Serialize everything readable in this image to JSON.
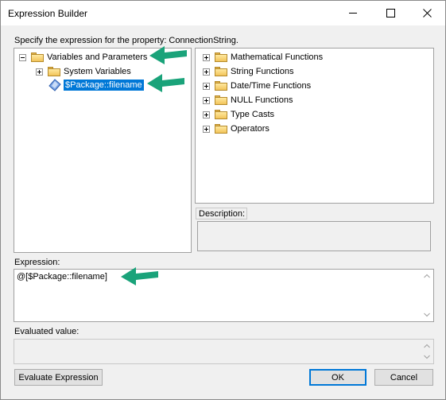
{
  "window": {
    "title": "Expression Builder",
    "minimize_icon": "minimize-icon",
    "maximize_icon": "maximize-icon",
    "close_icon": "close-icon"
  },
  "prompt": "Specify the expression for the property: ConnectionString.",
  "left_tree": {
    "root": {
      "label": "Variables and Parameters",
      "expanded": true
    },
    "children": [
      {
        "label": "System Variables",
        "expanded": false
      },
      {
        "label": "$Package::filename",
        "selected": true
      }
    ]
  },
  "right_tree": {
    "items": [
      {
        "label": "Mathematical Functions"
      },
      {
        "label": "String Functions"
      },
      {
        "label": "Date/Time Functions"
      },
      {
        "label": "NULL Functions"
      },
      {
        "label": "Type Casts"
      },
      {
        "label": "Operators"
      }
    ]
  },
  "description": {
    "label": "Description:",
    "value": ""
  },
  "expression": {
    "label": "Expression:",
    "value": "@[$Package::filename]"
  },
  "evaluated": {
    "label": "Evaluated value:",
    "value": ""
  },
  "buttons": {
    "evaluate": "Evaluate Expression",
    "ok": "OK",
    "cancel": "Cancel"
  },
  "colors": {
    "selection": "#0078d7",
    "annotation_arrow": "#1aa37a"
  }
}
